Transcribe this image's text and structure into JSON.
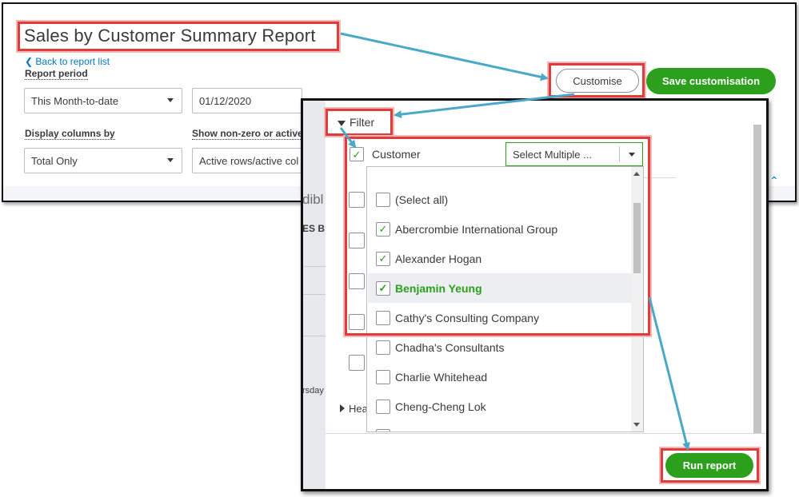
{
  "report": {
    "title": "Sales by Customer Summary Report",
    "back_link": "Back to report list",
    "report_period_label": "Report period",
    "period_value": "This Month-to-date",
    "date_from": "01/12/2020",
    "display_columns_label": "Display columns by",
    "display_columns_value": "Total Only",
    "show_nonzero_label": "Show non-zero or active o",
    "show_nonzero_value": "Active rows/active col",
    "customise_button": "Customise",
    "save_customisation_button": "Save customisation"
  },
  "background_fragments": {
    "partial_heading": "dibl",
    "partial_column": "ES B",
    "partial_day": "rsday",
    "partial_header": "Hea"
  },
  "customise_panel": {
    "filter_label": "Filter",
    "customer_label": "Customer",
    "select_value": "Select Multiple ...",
    "customer_options": [
      {
        "label": "(Select all)",
        "checked": false
      },
      {
        "label": "Abercrombie International Group",
        "checked": true
      },
      {
        "label": "Alexander Hogan",
        "checked": true
      },
      {
        "label": "Benjamin Yeung",
        "checked": true
      },
      {
        "label": "Cathy's Consulting Company",
        "checked": false
      },
      {
        "label": "Chadha's Consultants",
        "checked": false
      },
      {
        "label": "Charlie Whitehead",
        "checked": false
      },
      {
        "label": "Cheng-Cheng Lok",
        "checked": false
      }
    ],
    "run_report_button": "Run report"
  },
  "colors": {
    "accent_green": "#2ca01c",
    "link_blue": "#0077c5",
    "annotation_red": "#e03c3c",
    "annotation_arrow": "#4aa8c8"
  }
}
